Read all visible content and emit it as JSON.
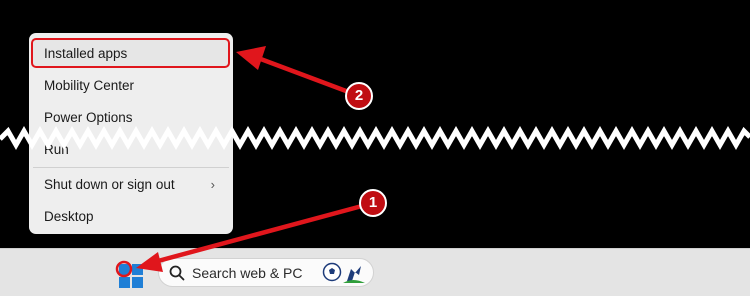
{
  "menu": {
    "items": [
      {
        "label": "Installed apps"
      },
      {
        "label": "Mobility Center"
      },
      {
        "label": "Power Options"
      },
      {
        "label": "Run"
      },
      {
        "label": "Shut down or sign out"
      },
      {
        "label": "Desktop"
      }
    ]
  },
  "taskbar": {
    "search_placeholder": "Search web & PC"
  },
  "annotations": {
    "step1": "1",
    "step2": "2"
  },
  "colors": {
    "annotation_red": "#e0161c",
    "taskbar_bg": "#e4e4e4",
    "menu_bg": "#eeeeee"
  },
  "icons": [
    "windows-start-icon",
    "search-icon",
    "soccer-ball-icon",
    "chevron-right-icon"
  ]
}
